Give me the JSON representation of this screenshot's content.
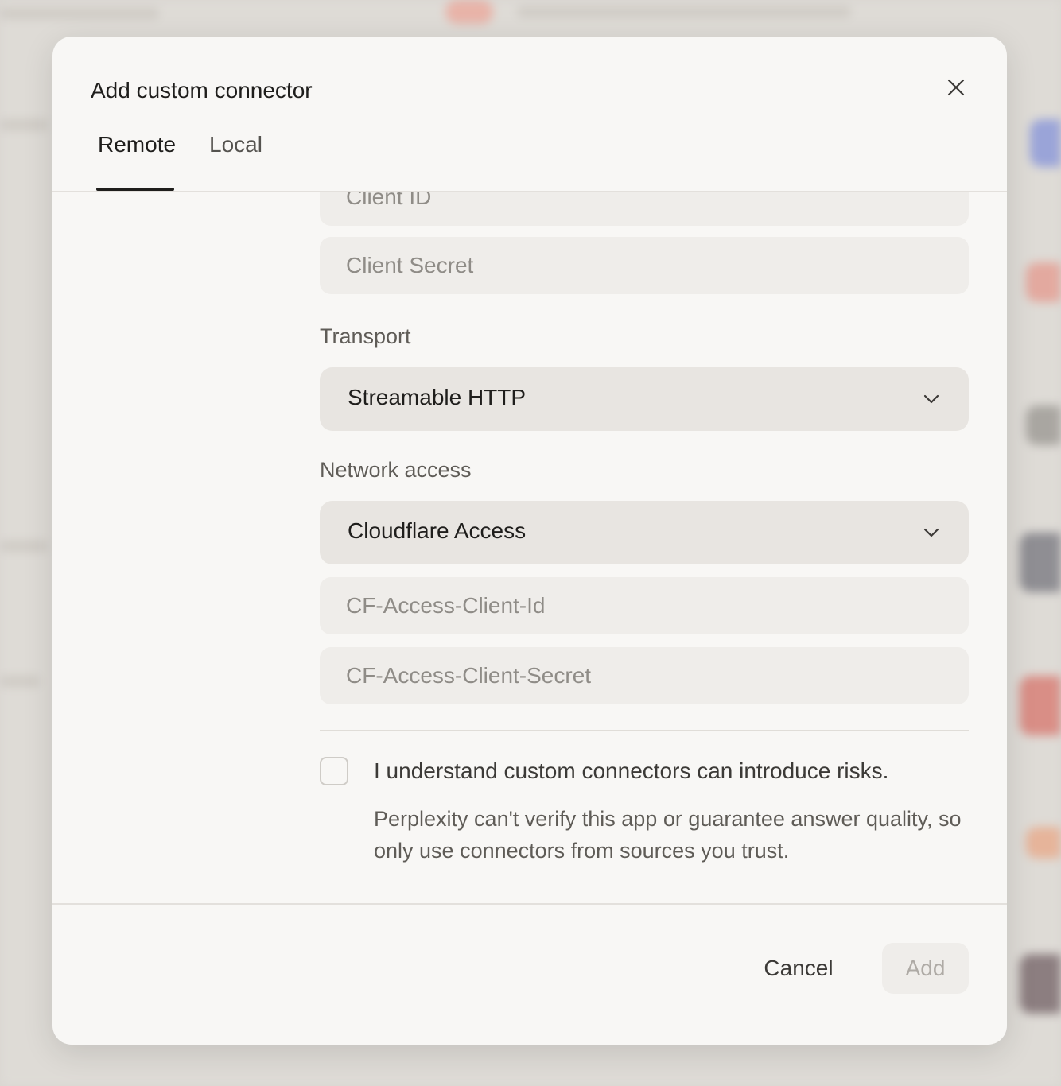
{
  "dialog": {
    "title": "Add custom connector",
    "close_icon": "close-icon"
  },
  "tabs": [
    {
      "label": "Remote",
      "active": true
    },
    {
      "label": "Local",
      "active": false
    }
  ],
  "form": {
    "client_id_placeholder": "Client ID",
    "client_secret_placeholder": "Client Secret",
    "transport_label": "Transport",
    "transport_value": "Streamable HTTP",
    "network_label": "Network access",
    "network_value": "Cloudflare Access",
    "cf_client_id_placeholder": "CF-Access-Client-Id",
    "cf_client_secret_placeholder": "CF-Access-Client-Secret",
    "risk_checkbox_checked": false,
    "risk_title": "I understand custom connectors can introduce risks.",
    "risk_description": "Perplexity can't verify this app or guarantee answer quality, so only use connectors from sources you trust."
  },
  "footer": {
    "cancel_label": "Cancel",
    "add_label": "Add"
  },
  "colors": {
    "modal_bg": "#f8f7f5",
    "field_bg": "#efedea",
    "select_bg": "#e8e5e1",
    "text_primary": "#1f1e1c",
    "text_muted": "#5f5c57"
  }
}
